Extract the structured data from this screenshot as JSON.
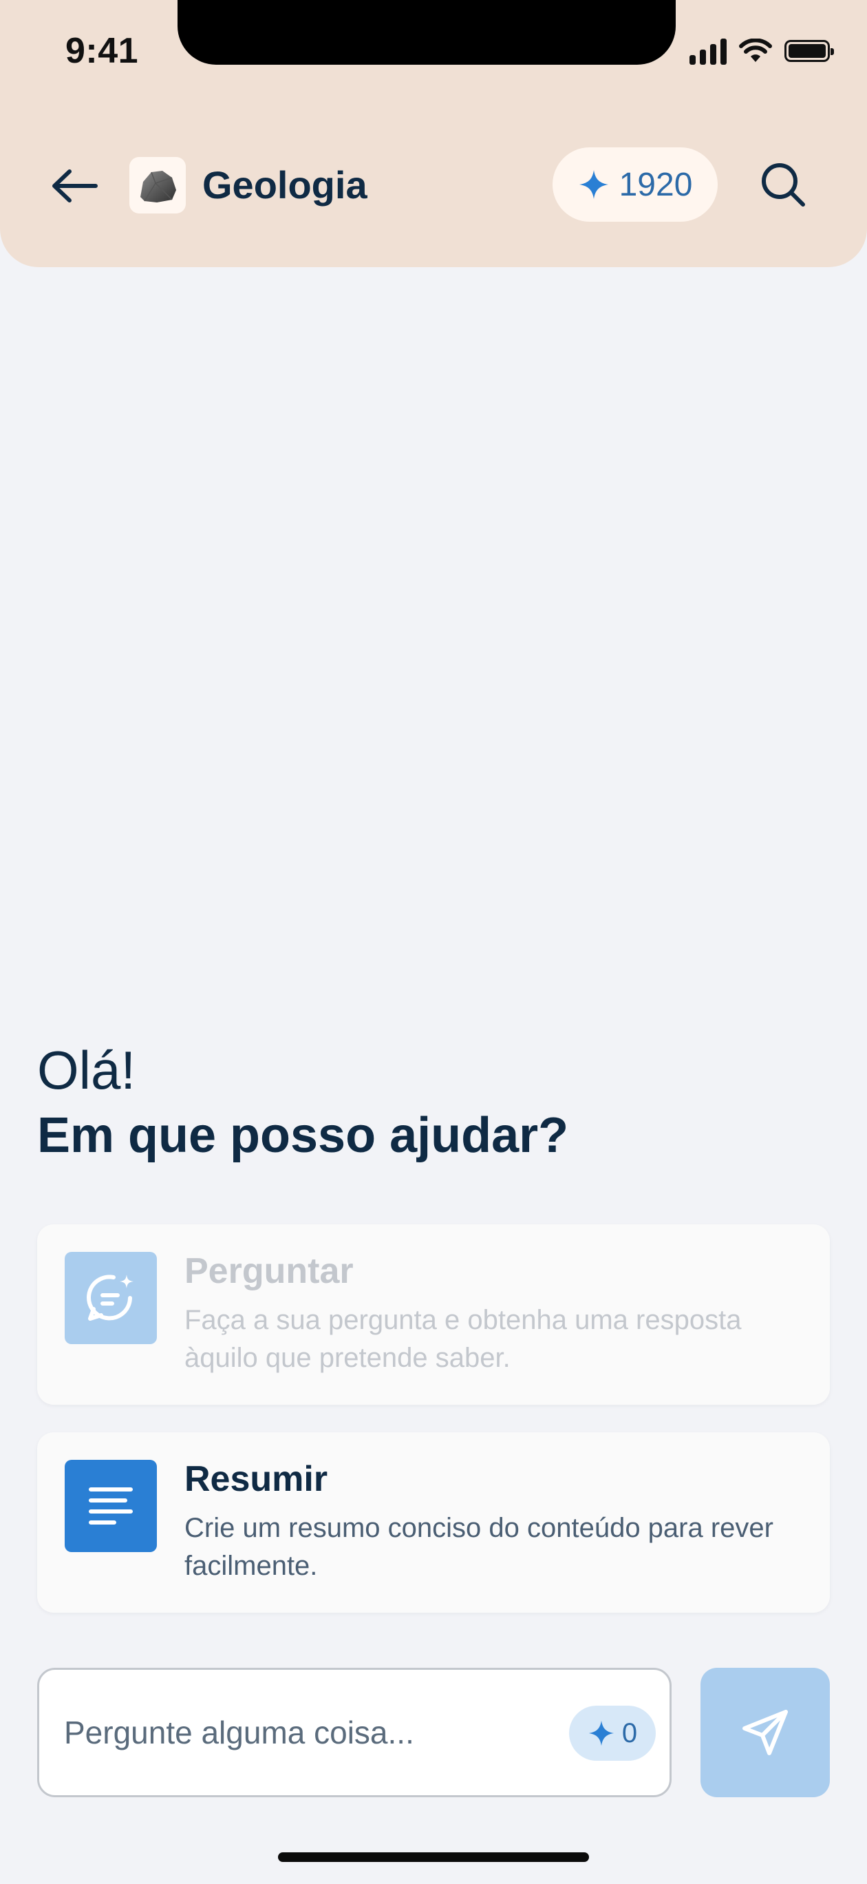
{
  "status_bar": {
    "time": "9:41"
  },
  "header": {
    "subject_title": "Geologia",
    "credits": "1920",
    "icons": [
      "back-arrow-icon",
      "rock-icon",
      "sparkle-icon",
      "search-icon"
    ]
  },
  "intro": {
    "greeting": "Olá!",
    "question": "Em que posso ajudar?"
  },
  "actions": [
    {
      "title": "Perguntar",
      "description": "Faça a sua pergunta e obtenha uma resposta àquilo que pretende saber.",
      "icon": "chat-sparkle-icon",
      "enabled": false
    },
    {
      "title": "Resumir",
      "description": "Crie um resumo conciso do conteúdo para rever facilmente.",
      "icon": "summary-lines-icon",
      "enabled": true
    }
  ],
  "composer": {
    "placeholder": "Pergunte alguma coisa...",
    "value": "",
    "cost": "0",
    "send_icon": "send-icon"
  },
  "colors": {
    "header_bg": "#f0e0d4",
    "page_bg": "#f2f3f7",
    "accent": "#2a7fd4",
    "accent_light": "#aacdee",
    "text_primary": "#0f2a44"
  }
}
